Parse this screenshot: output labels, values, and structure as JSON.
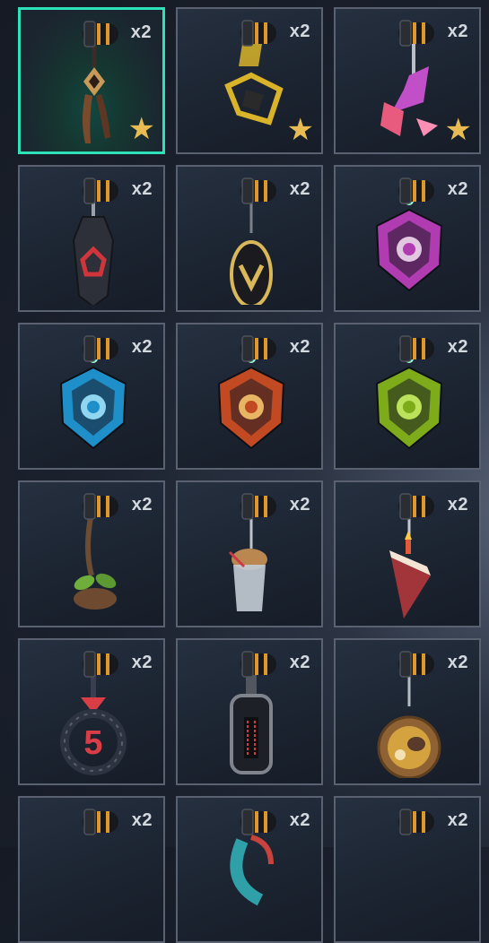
{
  "items": [
    {
      "name": "charm-bronze-tassel",
      "count": "x2",
      "starred": true,
      "selected": true,
      "kind": "tassel",
      "color": "#7a4a2c",
      "accent": "#c89a58"
    },
    {
      "name": "charm-gold-cube",
      "count": "x2",
      "starred": true,
      "selected": false,
      "kind": "cube",
      "color": "#d9b42a",
      "accent": "#2a2a2a"
    },
    {
      "name": "charm-crystal-arrow",
      "count": "x2",
      "starred": true,
      "selected": false,
      "kind": "arrow",
      "color": "#c14fc8",
      "accent": "#e85a7e"
    },
    {
      "name": "charm-red-tag",
      "count": "x2",
      "starred": false,
      "selected": false,
      "kind": "tag",
      "color": "#2d3038",
      "accent": "#d0353b"
    },
    {
      "name": "charm-v-oval",
      "count": "x2",
      "starred": false,
      "selected": false,
      "kind": "oval",
      "color": "#1b1b1f",
      "accent": "#d9b85a"
    },
    {
      "name": "charm-pink-rank",
      "count": "x2",
      "starred": false,
      "selected": false,
      "kind": "rank",
      "color": "#b13bb0",
      "accent": "#f0d8ee"
    },
    {
      "name": "charm-blue-rank",
      "count": "x2",
      "starred": false,
      "selected": false,
      "kind": "rank",
      "color": "#1f8fc9",
      "accent": "#9ee6ff"
    },
    {
      "name": "charm-orange-rank",
      "count": "x2",
      "starred": false,
      "selected": false,
      "kind": "rank",
      "color": "#c24a22",
      "accent": "#f5c46a"
    },
    {
      "name": "charm-green-rank",
      "count": "x2",
      "starred": false,
      "selected": false,
      "kind": "rank",
      "color": "#7dab19",
      "accent": "#c9f061"
    },
    {
      "name": "charm-sprout-pot",
      "count": "x2",
      "starred": false,
      "selected": false,
      "kind": "sprout",
      "color": "#6e4a31",
      "accent": "#6fae3a"
    },
    {
      "name": "charm-frappe-cup",
      "count": "x2",
      "starred": false,
      "selected": false,
      "kind": "cup",
      "color": "#c4cdd6",
      "accent": "#b9874f"
    },
    {
      "name": "charm-cake-slice",
      "count": "x2",
      "starred": false,
      "selected": false,
      "kind": "cake",
      "color": "#a2353a",
      "accent": "#f3e4d4"
    },
    {
      "name": "charm-five-ring",
      "count": "x2",
      "starred": false,
      "selected": false,
      "kind": "ring",
      "color": "#2e3340",
      "accent": "#d93d46"
    },
    {
      "name": "charm-black-keytag",
      "count": "x2",
      "starred": false,
      "selected": false,
      "kind": "keytag",
      "color": "#1d2026",
      "accent": "#d33a3e"
    },
    {
      "name": "charm-noodle-bowl",
      "count": "x2",
      "starred": false,
      "selected": false,
      "kind": "bowl",
      "color": "#8e6232",
      "accent": "#d4a23f"
    },
    {
      "name": "charm-partial-1",
      "count": "x2",
      "starred": false,
      "selected": false,
      "kind": "none",
      "color": "#333",
      "accent": "#333"
    },
    {
      "name": "charm-partial-2",
      "count": "x2",
      "starred": false,
      "selected": false,
      "kind": "feather",
      "color": "#2fa0a8",
      "accent": "#c8433c"
    },
    {
      "name": "charm-partial-3",
      "count": "x2",
      "starred": false,
      "selected": false,
      "kind": "none",
      "color": "#333",
      "accent": "#333"
    }
  ],
  "star_glyph": "★"
}
